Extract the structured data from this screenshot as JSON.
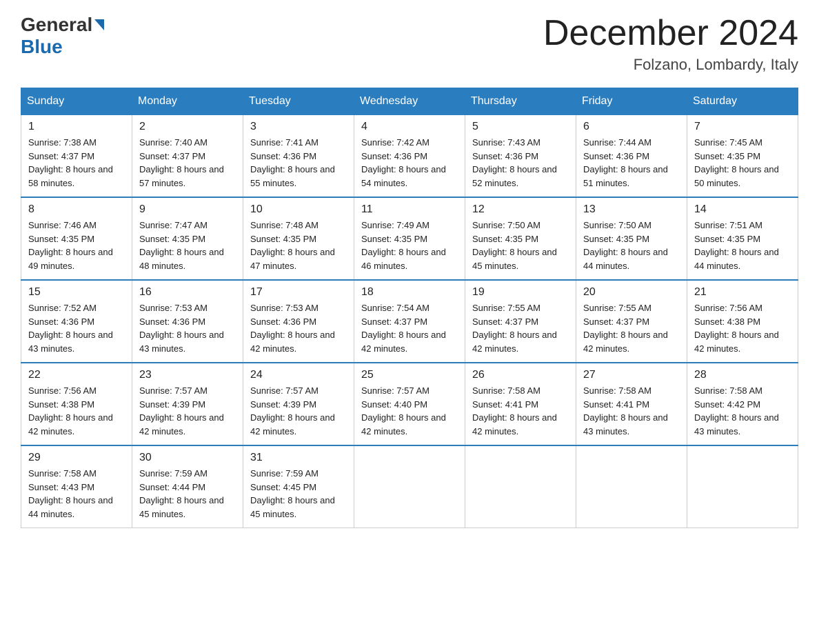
{
  "logo": {
    "general": "General",
    "blue": "Blue"
  },
  "header": {
    "title": "December 2024",
    "subtitle": "Folzano, Lombardy, Italy"
  },
  "days_of_week": [
    "Sunday",
    "Monday",
    "Tuesday",
    "Wednesday",
    "Thursday",
    "Friday",
    "Saturday"
  ],
  "weeks": [
    [
      {
        "day": "1",
        "sunrise": "7:38 AM",
        "sunset": "4:37 PM",
        "daylight": "8 hours and 58 minutes."
      },
      {
        "day": "2",
        "sunrise": "7:40 AM",
        "sunset": "4:37 PM",
        "daylight": "8 hours and 57 minutes."
      },
      {
        "day": "3",
        "sunrise": "7:41 AM",
        "sunset": "4:36 PM",
        "daylight": "8 hours and 55 minutes."
      },
      {
        "day": "4",
        "sunrise": "7:42 AM",
        "sunset": "4:36 PM",
        "daylight": "8 hours and 54 minutes."
      },
      {
        "day": "5",
        "sunrise": "7:43 AM",
        "sunset": "4:36 PM",
        "daylight": "8 hours and 52 minutes."
      },
      {
        "day": "6",
        "sunrise": "7:44 AM",
        "sunset": "4:36 PM",
        "daylight": "8 hours and 51 minutes."
      },
      {
        "day": "7",
        "sunrise": "7:45 AM",
        "sunset": "4:35 PM",
        "daylight": "8 hours and 50 minutes."
      }
    ],
    [
      {
        "day": "8",
        "sunrise": "7:46 AM",
        "sunset": "4:35 PM",
        "daylight": "8 hours and 49 minutes."
      },
      {
        "day": "9",
        "sunrise": "7:47 AM",
        "sunset": "4:35 PM",
        "daylight": "8 hours and 48 minutes."
      },
      {
        "day": "10",
        "sunrise": "7:48 AM",
        "sunset": "4:35 PM",
        "daylight": "8 hours and 47 minutes."
      },
      {
        "day": "11",
        "sunrise": "7:49 AM",
        "sunset": "4:35 PM",
        "daylight": "8 hours and 46 minutes."
      },
      {
        "day": "12",
        "sunrise": "7:50 AM",
        "sunset": "4:35 PM",
        "daylight": "8 hours and 45 minutes."
      },
      {
        "day": "13",
        "sunrise": "7:50 AM",
        "sunset": "4:35 PM",
        "daylight": "8 hours and 44 minutes."
      },
      {
        "day": "14",
        "sunrise": "7:51 AM",
        "sunset": "4:35 PM",
        "daylight": "8 hours and 44 minutes."
      }
    ],
    [
      {
        "day": "15",
        "sunrise": "7:52 AM",
        "sunset": "4:36 PM",
        "daylight": "8 hours and 43 minutes."
      },
      {
        "day": "16",
        "sunrise": "7:53 AM",
        "sunset": "4:36 PM",
        "daylight": "8 hours and 43 minutes."
      },
      {
        "day": "17",
        "sunrise": "7:53 AM",
        "sunset": "4:36 PM",
        "daylight": "8 hours and 42 minutes."
      },
      {
        "day": "18",
        "sunrise": "7:54 AM",
        "sunset": "4:37 PM",
        "daylight": "8 hours and 42 minutes."
      },
      {
        "day": "19",
        "sunrise": "7:55 AM",
        "sunset": "4:37 PM",
        "daylight": "8 hours and 42 minutes."
      },
      {
        "day": "20",
        "sunrise": "7:55 AM",
        "sunset": "4:37 PM",
        "daylight": "8 hours and 42 minutes."
      },
      {
        "day": "21",
        "sunrise": "7:56 AM",
        "sunset": "4:38 PM",
        "daylight": "8 hours and 42 minutes."
      }
    ],
    [
      {
        "day": "22",
        "sunrise": "7:56 AM",
        "sunset": "4:38 PM",
        "daylight": "8 hours and 42 minutes."
      },
      {
        "day": "23",
        "sunrise": "7:57 AM",
        "sunset": "4:39 PM",
        "daylight": "8 hours and 42 minutes."
      },
      {
        "day": "24",
        "sunrise": "7:57 AM",
        "sunset": "4:39 PM",
        "daylight": "8 hours and 42 minutes."
      },
      {
        "day": "25",
        "sunrise": "7:57 AM",
        "sunset": "4:40 PM",
        "daylight": "8 hours and 42 minutes."
      },
      {
        "day": "26",
        "sunrise": "7:58 AM",
        "sunset": "4:41 PM",
        "daylight": "8 hours and 42 minutes."
      },
      {
        "day": "27",
        "sunrise": "7:58 AM",
        "sunset": "4:41 PM",
        "daylight": "8 hours and 43 minutes."
      },
      {
        "day": "28",
        "sunrise": "7:58 AM",
        "sunset": "4:42 PM",
        "daylight": "8 hours and 43 minutes."
      }
    ],
    [
      {
        "day": "29",
        "sunrise": "7:58 AM",
        "sunset": "4:43 PM",
        "daylight": "8 hours and 44 minutes."
      },
      {
        "day": "30",
        "sunrise": "7:59 AM",
        "sunset": "4:44 PM",
        "daylight": "8 hours and 45 minutes."
      },
      {
        "day": "31",
        "sunrise": "7:59 AM",
        "sunset": "4:45 PM",
        "daylight": "8 hours and 45 minutes."
      },
      null,
      null,
      null,
      null
    ]
  ],
  "labels": {
    "sunrise": "Sunrise:",
    "sunset": "Sunset:",
    "daylight": "Daylight:"
  }
}
